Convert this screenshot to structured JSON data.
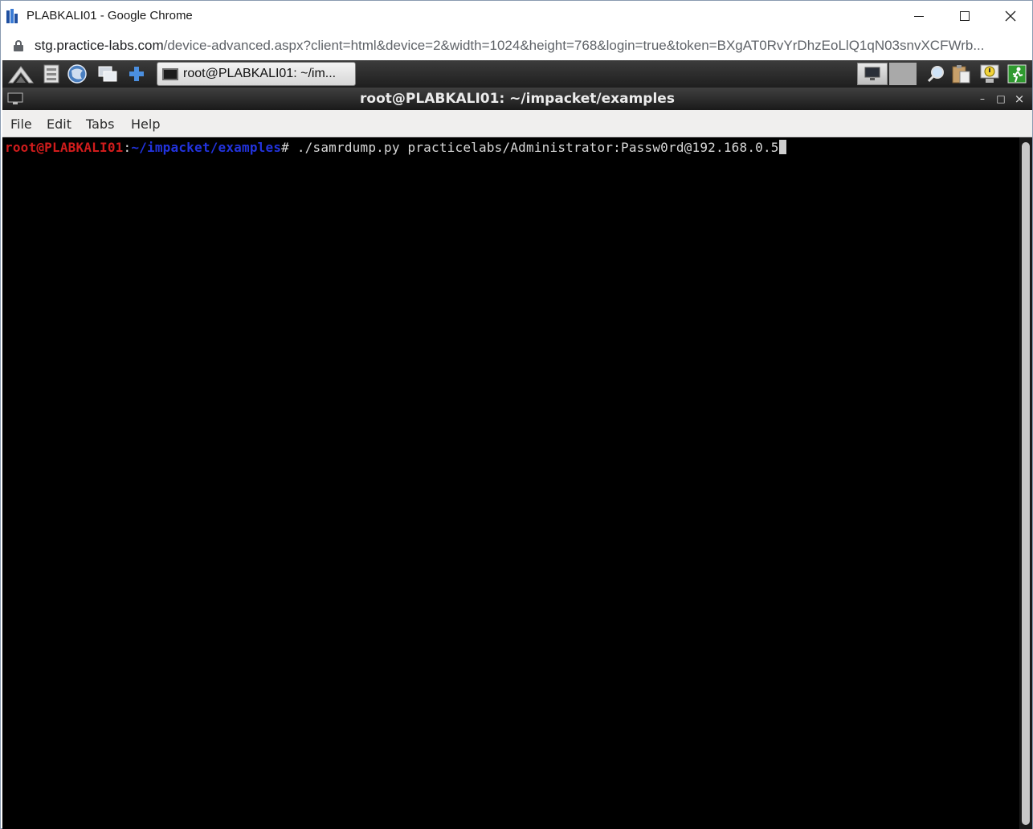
{
  "browser": {
    "window_title": "PLABKALI01 - Google Chrome",
    "url_host": "stg.practice-labs.com",
    "url_path": "/device-advanced.aspx?client=html&device=2&width=1024&height=768&login=true&token=BXgAT0RvYrDhzEoLlQ1qN03snvXCFWrb..."
  },
  "taskbar": {
    "icons": [
      "kali-menu-icon",
      "file-manager-icon",
      "browser-icon",
      "show-desktop-icon",
      "add-icon"
    ],
    "task_label": "root@PLABKALI01: ~/im...",
    "tray_icons": [
      "monitor-icon",
      "blank-tray-icon",
      "search-icon",
      "clipboard-icon",
      "notification-icon",
      "logout-icon"
    ]
  },
  "terminal": {
    "title": "root@PLABKALI01: ~/impacket/examples",
    "controls": {
      "minimize": "–",
      "maximize": "□",
      "close": "×"
    },
    "menu": [
      "File",
      "Edit",
      "Tabs",
      "Help"
    ],
    "prompt_user": "root@PLABKALI01",
    "prompt_sep": ":",
    "prompt_path": "~/impacket/examples",
    "prompt_symbol": "# ",
    "command": "./samrdump.py practicelabs/Administrator:Passw0rd@192.168.0.5"
  },
  "colors": {
    "prompt_user": "#d01c1c",
    "prompt_path": "#2233dd",
    "terminal_bg": "#000000",
    "terminal_fg": "#d8d8d8"
  }
}
